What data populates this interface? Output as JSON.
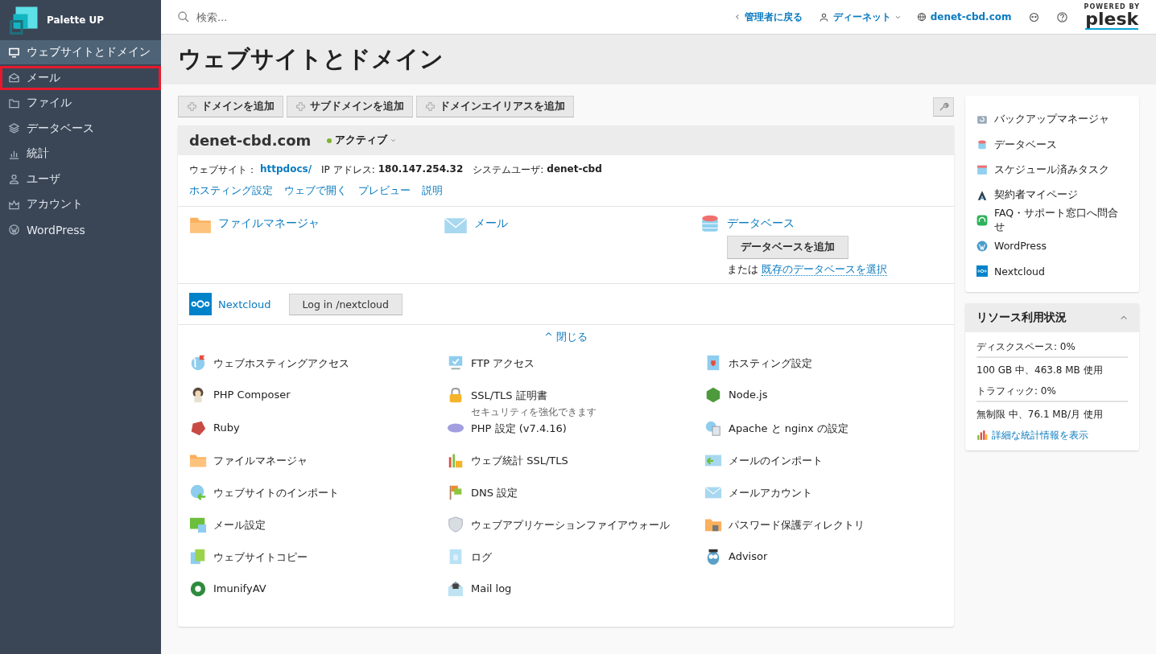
{
  "brand": {
    "name": "Palette UP"
  },
  "sidebar": {
    "items": [
      {
        "label": "ウェブサイトとドメイン",
        "selected": true,
        "highlighted": false,
        "kind": "monitor"
      },
      {
        "label": "メール",
        "selected": false,
        "highlighted": true,
        "kind": "mail"
      },
      {
        "label": "ファイル",
        "selected": false,
        "highlighted": false,
        "kind": "folder"
      },
      {
        "label": "データベース",
        "selected": false,
        "highlighted": false,
        "kind": "layers"
      },
      {
        "label": "統計",
        "selected": false,
        "highlighted": false,
        "kind": "chart"
      },
      {
        "label": "ユーザ",
        "selected": false,
        "highlighted": false,
        "kind": "user"
      },
      {
        "label": "アカウント",
        "selected": false,
        "highlighted": false,
        "kind": "crown"
      },
      {
        "label": "WordPress",
        "selected": false,
        "highlighted": false,
        "kind": "wordpress"
      }
    ]
  },
  "topbar": {
    "search": {
      "placeholder": "検索..."
    },
    "back_link": "管理者に戻る",
    "user": "ディーネット",
    "domain": "denet-cbd.com",
    "powered_by": "POWERED BY",
    "product": "plesk"
  },
  "page": {
    "title": "ウェブサイトとドメイン"
  },
  "toolbar": {
    "buttons": [
      "ドメインを追加",
      "サブドメインを追加",
      "ドメインエイリアスを追加"
    ]
  },
  "domain": {
    "name": "denet-cbd.com",
    "status": "アクティブ",
    "active": true,
    "info": [
      {
        "label": "ウェブサイト：",
        "value": "httpdocs/",
        "kind": "link"
      },
      {
        "label": "IP アドレス:",
        "value": "180.147.254.32",
        "kind": "text"
      },
      {
        "label": "システムユーザ:",
        "value": "denet-cbd",
        "kind": "text"
      }
    ],
    "links": [
      "ホスティング設定",
      "ウェブで開く",
      "プレビュー",
      "説明"
    ],
    "quick": [
      {
        "label": "ファイルマネージャ",
        "kind": "folder"
      },
      {
        "label": "メール",
        "kind": "mail"
      },
      {
        "label": "データベース",
        "kind": "database",
        "button": "データベースを追加",
        "or_text": "または",
        "select_link": "既存のデータベースを選択"
      }
    ],
    "nextcloud": {
      "label": "Nextcloud",
      "button": "Log in /nextcloud"
    },
    "collapse": "^ 閉じる",
    "tools": [
      {
        "label": "ウェブホスティングアクセス"
      },
      {
        "label": "FTP アクセス"
      },
      {
        "label": "ホスティング設定"
      },
      {
        "label": "PHP Composer"
      },
      {
        "label": "SSL/TLS 証明書",
        "description": "セキュリティを強化できます"
      },
      {
        "label": "Node.js"
      },
      {
        "label": "Ruby"
      },
      {
        "label": "PHP 設定 (v7.4.16)"
      },
      {
        "label": "Apache と nginx の設定"
      },
      {
        "label": "ファイルマネージャ"
      },
      {
        "label": "ウェブ統計 SSL/TLS"
      },
      {
        "label": "メールのインポート"
      },
      {
        "label": "ウェブサイトのインポート"
      },
      {
        "label": "DNS 設定"
      },
      {
        "label": "メールアカウント"
      },
      {
        "label": "メール設定"
      },
      {
        "label": "ウェブアプリケーションファイアウォール"
      },
      {
        "label": "パスワード保護ディレクトリ"
      },
      {
        "label": "ウェブサイトコピー"
      },
      {
        "label": "ログ"
      },
      {
        "label": "Advisor"
      },
      {
        "label": "ImunifyAV"
      },
      {
        "label": "Mail log"
      }
    ]
  },
  "side_links": [
    "バックアップマネージャ",
    "データベース",
    "スケジュール済みタスク",
    "契約者マイページ",
    "FAQ・サポート窓口へ問合せ",
    "WordPress",
    "Nextcloud"
  ],
  "resources": {
    "title": "リソース利用状況",
    "expanded": true,
    "meters": [
      {
        "label": "ディスクスペース: 0%",
        "level": 0,
        "detail": "100 GB 中、463.8 MB 使用"
      },
      {
        "label": "トラフィック: 0%",
        "level": 0,
        "detail": "無制限 中、76.1 MB/月 使用"
      }
    ],
    "stats_link": "詳細な統計情報を表示"
  }
}
